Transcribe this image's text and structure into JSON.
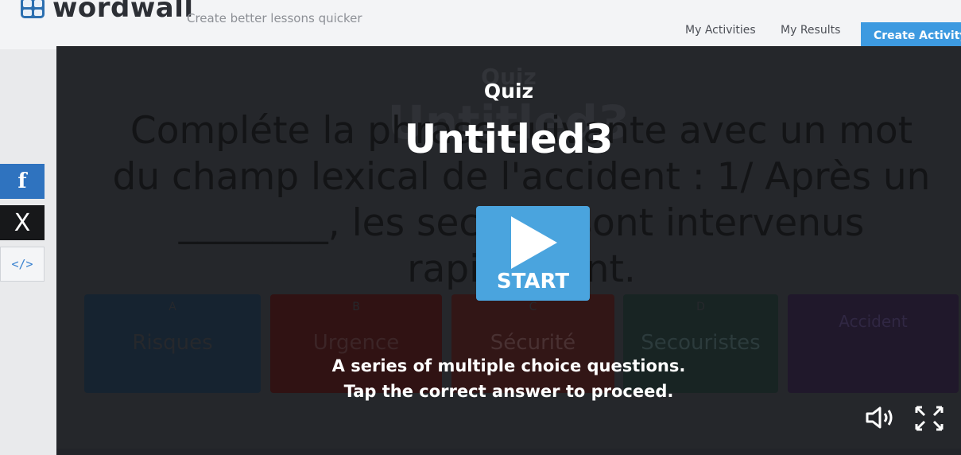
{
  "header": {
    "logo_text": "wordwall",
    "tagline": "Create better lessons quicker",
    "nav": {
      "my_activities": "My Activities",
      "my_results": "My Results",
      "create_activity": "Create Activity"
    }
  },
  "share": {
    "facebook": "f",
    "x": "X",
    "embed": "</>"
  },
  "game": {
    "bg_title": "Quiz",
    "bg_subtitle": "Untitled3",
    "question": "Compléte la phrase suivante avec un mot du champ lexical de l'accident : 1/ Après un ________, les secours sont intervenus rapidement.",
    "answers": [
      {
        "letter": "A",
        "text": "Risques"
      },
      {
        "letter": "B",
        "text": "Urgence"
      },
      {
        "letter": "C",
        "text": "Sécurité"
      },
      {
        "letter": "D",
        "text": "Secouristes"
      },
      {
        "letter": "",
        "text": "Accident"
      }
    ],
    "overlay": {
      "label": "Quiz",
      "title": "Untitled3",
      "start": "START",
      "desc_line1": "A series of multiple choice questions.",
      "desc_line2": "Tap the correct answer to proceed."
    },
    "controls": {
      "sound_icon": "speaker-icon",
      "fullscreen_icon": "fullscreen-icon"
    }
  }
}
